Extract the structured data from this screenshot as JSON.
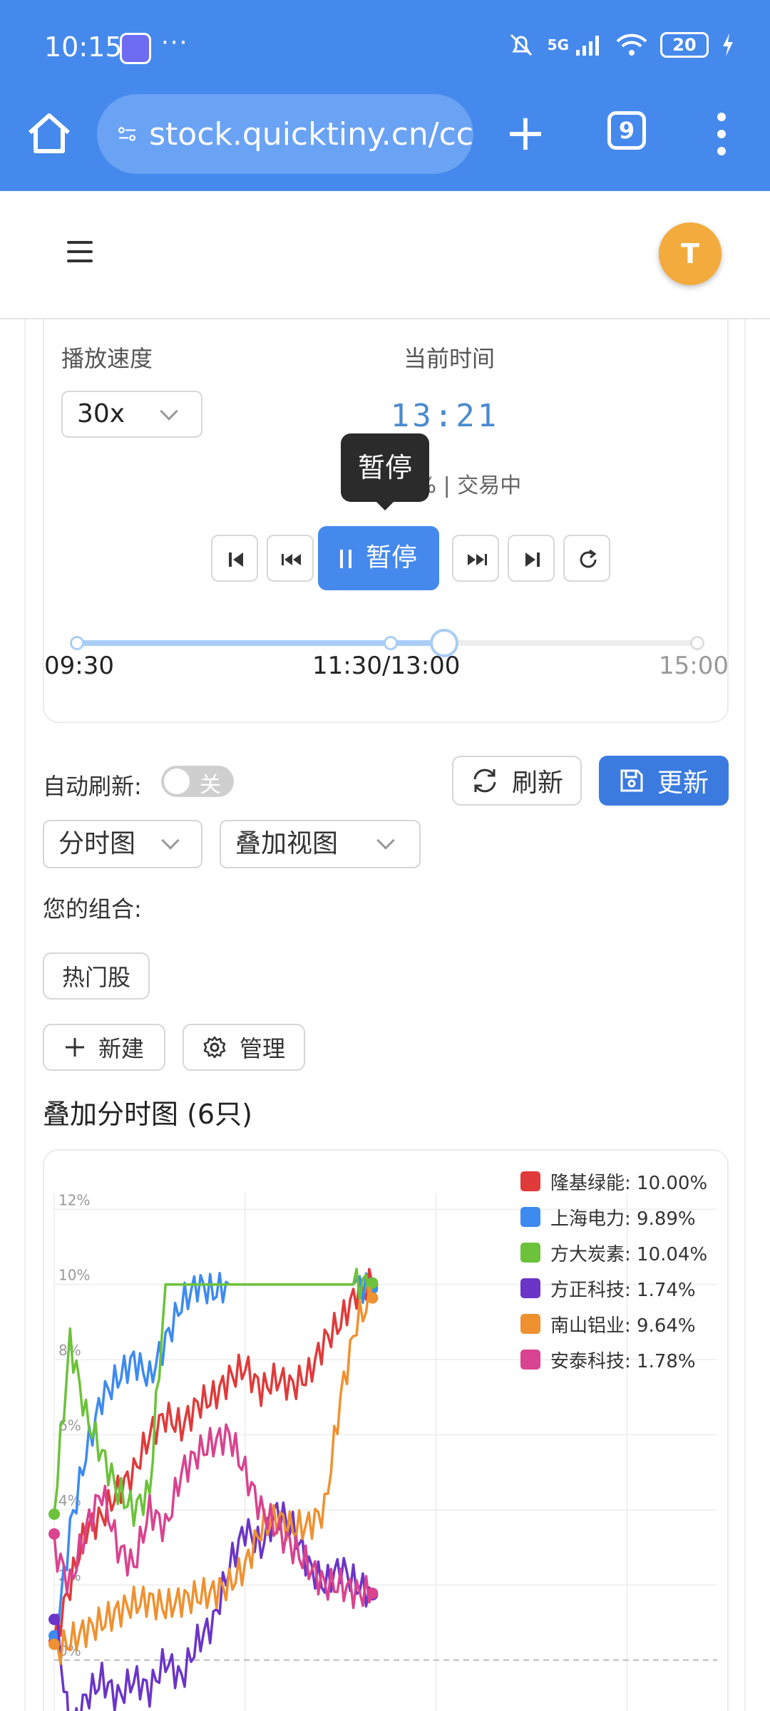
{
  "status": {
    "time": "10:15",
    "dots": "···",
    "network": "5G",
    "battery": "20"
  },
  "browser": {
    "url": "stock.quicktiny.cn/cc",
    "tab_count": "9"
  },
  "user": {
    "initial": "T"
  },
  "player": {
    "speed_label": "播放速度",
    "speed_value": "30x",
    "time_label": "当前时间",
    "current_time": "13:21",
    "progress_text": "58.8% | 交易中",
    "progress": 0.588,
    "tooltip": "暂停",
    "pause_label": "暂停",
    "ticks": [
      "09:30",
      "11:30/13:00",
      "15:00"
    ]
  },
  "toolbar": {
    "auto_refresh_label": "自动刷新:",
    "toggle_text": "关",
    "refresh_label": "刷新",
    "update_label": "更新",
    "chart_type": "分时图",
    "view_mode": "叠加视图",
    "portfolio_label": "您的组合:",
    "portfolio_chip": "热门股",
    "new_label": "新建",
    "manage_label": "管理"
  },
  "section_title": "叠加分时图 (6只)",
  "colors": {
    "accent": "#4589ec",
    "primary_button": "#3b7be0",
    "avatar": "#f2ab3c"
  },
  "chart_data": {
    "type": "line",
    "y_ticks": [
      "12%",
      "10%",
      "8%",
      "6%",
      "4%",
      "2%",
      "0%"
    ],
    "ylim": [
      -2,
      13
    ],
    "x": [
      0,
      10,
      20,
      30,
      40,
      50,
      60,
      70,
      80,
      90,
      100,
      110,
      120,
      130,
      140,
      150,
      160,
      170,
      180,
      190,
      200
    ],
    "legend": [
      {
        "label": "隆基绿能: 10.00%",
        "color": "#e03a3a"
      },
      {
        "label": "上海电力: 9.89%",
        "color": "#3d8af0"
      },
      {
        "label": "方大炭素: 10.04%",
        "color": "#6cc23a"
      },
      {
        "label": "方正科技: 1.74%",
        "color": "#6a35c8"
      },
      {
        "label": "南山铝业: 9.64%",
        "color": "#ef9130"
      },
      {
        "label": "安泰科技: 1.78%",
        "color": "#d9438f"
      }
    ],
    "series": [
      {
        "name": "隆基绿能",
        "color": "#e03a3a",
        "values": [
          0.5,
          2.0,
          3.5,
          3.8,
          4.5,
          5.0,
          6.0,
          6.5,
          6.2,
          6.8,
          7.0,
          7.5,
          7.8,
          7.2,
          7.5,
          7.3,
          7.6,
          8.5,
          9.0,
          9.8,
          10.0
        ]
      },
      {
        "name": "上海电力",
        "color": "#3d8af0",
        "values": [
          0.2,
          3.5,
          5.5,
          7.0,
          7.5,
          8.0,
          7.5,
          8.5,
          9.5,
          10.0,
          9.8,
          10.0,
          10.0,
          10.0,
          10.0,
          10.0,
          10.0,
          10.0,
          10.0,
          10.0,
          9.89
        ]
      },
      {
        "name": "方大炭素",
        "color": "#6cc23a",
        "values": [
          4.0,
          8.5,
          6.5,
          5.5,
          4.5,
          4.0,
          4.5,
          10.0,
          10.0,
          10.0,
          10.0,
          10.0,
          10.0,
          10.0,
          10.0,
          10.0,
          10.0,
          10.0,
          10.0,
          10.0,
          10.04
        ]
      },
      {
        "name": "方正科技",
        "color": "#6a35c8",
        "values": [
          1.5,
          -2.0,
          -1.0,
          -0.5,
          -1.0,
          -0.5,
          -0.8,
          0.0,
          -0.5,
          0.5,
          1.0,
          2.5,
          3.5,
          3.0,
          4.0,
          3.5,
          2.5,
          2.0,
          2.5,
          2.0,
          1.74
        ]
      },
      {
        "name": "南山铝业",
        "color": "#ef9130",
        "values": [
          0.2,
          0.5,
          0.8,
          1.0,
          1.3,
          1.5,
          1.6,
          1.4,
          1.6,
          1.7,
          1.8,
          2.0,
          2.5,
          3.5,
          3.8,
          3.5,
          3.6,
          4.0,
          7.0,
          9.0,
          9.64
        ]
      },
      {
        "name": "安泰科技",
        "color": "#d9438f",
        "values": [
          3.0,
          2.0,
          3.5,
          4.5,
          3.0,
          2.5,
          4.0,
          3.5,
          5.0,
          5.5,
          5.8,
          6.0,
          5.0,
          4.0,
          3.5,
          3.0,
          2.5,
          2.0,
          2.0,
          1.8,
          1.78
        ]
      }
    ]
  }
}
